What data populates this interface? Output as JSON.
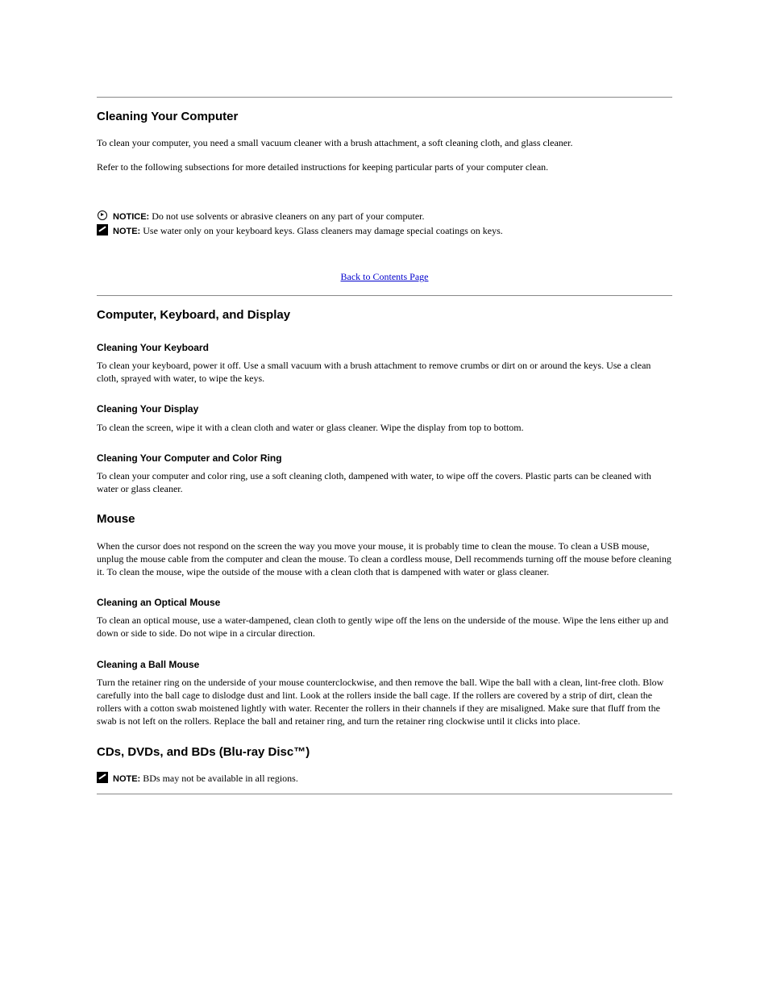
{
  "section1": {
    "rule_before": true,
    "heading": "Cleaning Your Computer",
    "paragraphs": [
      "To clean your computer, you need a small vacuum cleaner with a brush attachment, a soft cleaning cloth, and glass cleaner.",
      "Refer to the following subsections for more detailed instructions for keeping particular parts of your computer clean."
    ],
    "notice": {
      "label": "NOTICE:",
      "text": "Do not use solvents or abrasive cleaners on any part of your computer."
    },
    "note": {
      "label": "NOTE:",
      "text": "Use water only on your keyboard keys. Glass cleaners may damage special coatings on keys."
    }
  },
  "back_link": {
    "label": "Back to Contents Page",
    "href": "#"
  },
  "section2": {
    "heading": "Computer, Keyboard, and Display",
    "sub1": {
      "title": "Cleaning Your Keyboard",
      "text": "To clean your keyboard, power it off. Use a small vacuum with a brush attachment to remove crumbs or dirt on or around the keys. Use a clean cloth, sprayed with water, to wipe the keys."
    },
    "sub2": {
      "title": "Cleaning Your Display",
      "text": "To clean the screen, wipe it with a clean cloth and water or glass cleaner. Wipe the display from top to bottom."
    },
    "sub3": {
      "title": "Cleaning Your Computer and Color Ring",
      "text": "To clean your computer and color ring, use a soft cleaning cloth, dampened with water, to wipe off the covers. Plastic parts can be cleaned with water or glass cleaner."
    }
  },
  "section3": {
    "heading": "Mouse",
    "paragraphs": [
      "When the cursor does not respond on the screen the way you move your mouse, it is probably time to clean the mouse. To clean a USB mouse, unplug the mouse cable from the computer and clean the mouse. To clean a cordless mouse, Dell recommends turning off the mouse before cleaning it. To clean the mouse, wipe the outside of the mouse with a clean cloth that is dampened with water or glass cleaner."
    ],
    "sub1": {
      "title": "Cleaning an Optical Mouse",
      "text": "To clean an optical mouse, use a water-dampened, clean cloth to gently wipe off the lens on the underside of the mouse. Wipe the lens either up and down or side to side. Do not wipe in a circular direction."
    },
    "sub2": {
      "title": "Cleaning a Ball Mouse",
      "text": "Turn the retainer ring on the underside of your mouse counterclockwise, and then remove the ball. Wipe the ball with a clean, lint-free cloth. Blow carefully into the ball cage to dislodge dust and lint. Look at the rollers inside the ball cage. If the rollers are covered by a strip of dirt, clean the rollers with a cotton swab moistened lightly with water. Recenter the rollers in their channels if they are misaligned. Make sure that fluff from the swab is not left on the rollers. Replace the ball and retainer ring, and turn the retainer ring clockwise until it clicks into place."
    }
  },
  "section4": {
    "heading": "CDs, DVDs, and BDs (Blu-ray Disc™)",
    "note": {
      "label": "NOTE:",
      "text": "BDs may not be available in all regions."
    }
  }
}
